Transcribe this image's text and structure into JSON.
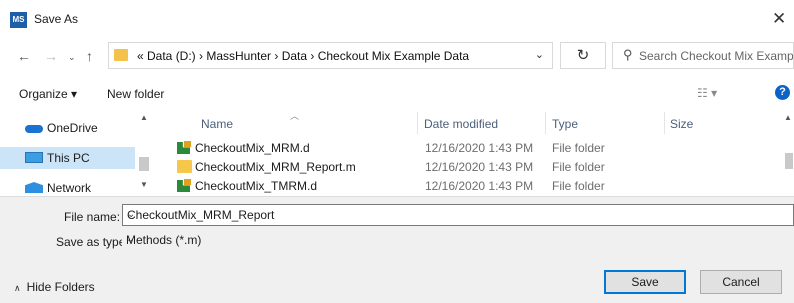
{
  "window": {
    "title": "Save As",
    "app_icon_text": "MS"
  },
  "address_bar": {
    "breadcrumbs": "«  Data (D:)  ›  MassHunter  ›  Data  ›  Checkout Mix Example Data",
    "search_placeholder": "Search Checkout Mix Examp..."
  },
  "toolbar": {
    "organize_label": "Organize ▾",
    "new_folder_label": "New folder"
  },
  "nav_pane": {
    "items": [
      {
        "label": "OneDrive",
        "selected": false
      },
      {
        "label": "This PC",
        "selected": true
      },
      {
        "label": "Network",
        "selected": false
      }
    ]
  },
  "file_list": {
    "columns": {
      "name": "Name",
      "date_modified": "Date modified",
      "type": "Type",
      "size": "Size"
    },
    "rows": [
      {
        "name": "CheckoutMix_MRM.d",
        "date": "12/16/2020 1:43 PM",
        "type": "File folder",
        "icon": "data-folder-icon"
      },
      {
        "name": "CheckoutMix_MRM_Report.m",
        "date": "12/16/2020 1:43 PM",
        "type": "File folder",
        "icon": "folder-icon"
      },
      {
        "name": "CheckoutMix_TMRM.d",
        "date": "12/16/2020 1:43 PM",
        "type": "File folder",
        "icon": "data-folder-icon"
      }
    ]
  },
  "form": {
    "file_name_label": "File name:",
    "file_name_value": "CheckoutMix_MRM_Report",
    "save_type_label": "Save as type:",
    "save_type_value": "Methods (*.m)"
  },
  "footer": {
    "hide_folders_label": "Hide Folders",
    "save_label": "Save",
    "cancel_label": "Cancel"
  },
  "colors": {
    "accent": "#0078d7",
    "selection": "#cce4f7",
    "folder": "#f5c84c"
  }
}
